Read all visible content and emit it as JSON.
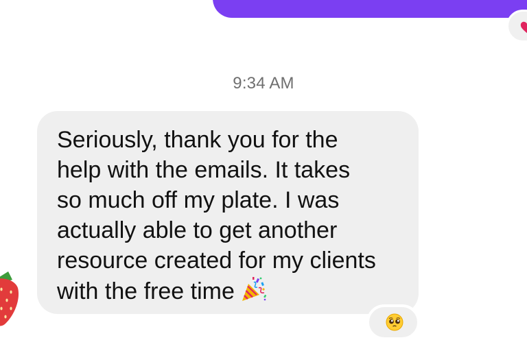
{
  "chat": {
    "timestamp": "9:34 AM",
    "received_message": {
      "lines": [
        "Seriously, thank you for the",
        "help with the emails. It takes",
        "so much off my plate. I was",
        "actually able to get another",
        "resource created for my clients",
        "with the free time"
      ],
      "trailing_emoji": "party-popper-icon",
      "reaction": "pleading-face-icon"
    },
    "sent_message": {
      "reaction": "heart-icon"
    },
    "sender_avatar": "strawberry-icon"
  },
  "colors": {
    "sent_bubble": "#7b3ff2",
    "received_bubble": "#efefef",
    "timestamp_text": "#6f6f6f",
    "message_text": "#111111"
  }
}
